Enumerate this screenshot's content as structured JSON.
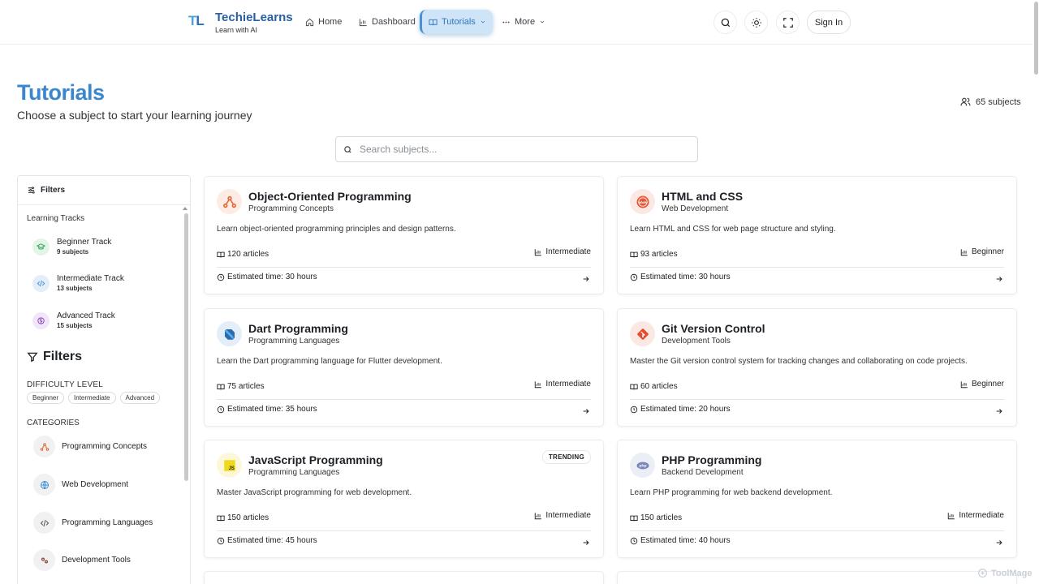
{
  "header": {
    "logo": {
      "mark_a": "T",
      "mark_b": "L"
    },
    "brand_name": "TechieLearns",
    "brand_tagline": "Learn with AI",
    "nav": {
      "home": "Home",
      "dashboard": "Dashboard",
      "tutorials": "Tutorials",
      "more": "More"
    },
    "sign_in": "Sign In"
  },
  "page": {
    "title": "Tutorials",
    "subtitle": "Choose a subject to start your learning journey",
    "subject_count": "65 subjects"
  },
  "search": {
    "placeholder": "Search subjects..."
  },
  "sidebar": {
    "header": "Filters",
    "tracks_label": "Learning Tracks",
    "tracks": [
      {
        "name": "Beginner Track",
        "count": "9 subjects",
        "color": "#3aa55d"
      },
      {
        "name": "Intermediate Track",
        "count": "13 subjects",
        "color": "#4a90d9"
      },
      {
        "name": "Advanced Track",
        "count": "15 subjects",
        "color": "#8e4bc2"
      }
    ],
    "filters_title": "Filters",
    "difficulty_label": "DIFFICULTY LEVEL",
    "difficulty_options": [
      "Beginner",
      "Intermediate",
      "Advanced"
    ],
    "categories_label": "CATEGORIES",
    "categories": [
      "Programming Concepts",
      "Web Development",
      "Programming Languages",
      "Development Tools"
    ]
  },
  "cards": [
    {
      "title": "Object-Oriented Programming",
      "category": "Programming Concepts",
      "description": "Learn object-oriented programming principles and design patterns.",
      "articles": "120 articles",
      "level": "Intermediate",
      "time": "Estimated time: 30 hours"
    },
    {
      "title": "HTML and CSS",
      "category": "Web Development",
      "description": "Learn HTML and CSS for web page structure and styling.",
      "articles": "93 articles",
      "level": "Beginner",
      "time": "Estimated time: 30 hours"
    },
    {
      "title": "Dart Programming",
      "category": "Programming Languages",
      "description": "Learn the Dart programming language for Flutter development.",
      "articles": "75 articles",
      "level": "Intermediate",
      "time": "Estimated time: 35 hours"
    },
    {
      "title": "Git Version Control",
      "category": "Development Tools",
      "description": "Master the Git version control system for tracking changes and collaborating on code projects.",
      "articles": "60 articles",
      "level": "Beginner",
      "time": "Estimated time: 20 hours"
    },
    {
      "title": "JavaScript Programming",
      "category": "Programming Languages",
      "description": "Master JavaScript programming for web development.",
      "articles": "150 articles",
      "level": "Intermediate",
      "time": "Estimated time: 45 hours",
      "badge": "TRENDING",
      "icon_text": "JS"
    },
    {
      "title": "PHP Programming",
      "category": "Backend Development",
      "description": "Learn PHP programming for web backend development.",
      "articles": "150 articles",
      "level": "Intermediate",
      "time": "Estimated time: 40 hours",
      "icon_text": "php"
    }
  ],
  "watermark": "ToolMage",
  "colors": {
    "accent": "#3a86cf",
    "nav_active_bg": "#cfe5f7",
    "brand": "#2a5f9e"
  }
}
